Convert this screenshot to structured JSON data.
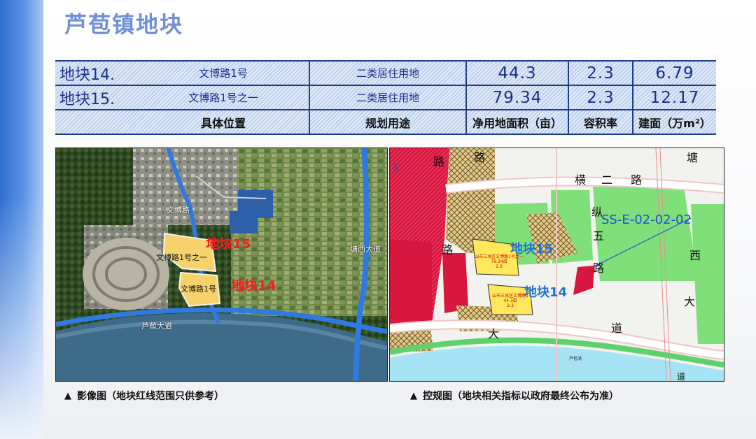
{
  "title": "芦苞镇地块",
  "table": {
    "rows": [
      {
        "id": "地块14.",
        "location": "文博路1号",
        "use": "二类居住用地",
        "area": "44.3",
        "far": "2.3",
        "gfa": "6.79"
      },
      {
        "id": "地块15.",
        "location": "文博路1号之一",
        "use": "二类居住用地",
        "area": "79.34",
        "far": "2.3",
        "gfa": "12.17"
      }
    ],
    "header": {
      "location": "具体位置",
      "use": "规划用途",
      "area": "净用地面积（亩）",
      "far": "容积率",
      "gfa": "建面（万m²）"
    }
  },
  "left_map": {
    "labels": {
      "road_wenbo": "文博路",
      "plot15_address": "文博路1号之一",
      "plot14_address": "文博路1号",
      "plot15": "地块15",
      "plot14": "地块14",
      "road_tangxi": "塘西大道",
      "road_lubao": "芦苞大道"
    },
    "caption": "影像图（地块红线范围只供参考）"
  },
  "right_map": {
    "labels": {
      "corner_number": "1",
      "road_lu_top": "路",
      "road_lu_top2": "路",
      "road_heng": "横",
      "road_er": "二",
      "road_lu_h": "路",
      "road_zong": "纵",
      "road_wu": "五",
      "road_lu_v": "路",
      "road_tang": "塘",
      "road_xi": "西",
      "road_da": "大",
      "road_da2": "大",
      "road_dao": "道",
      "road_lu_mid": "路",
      "zone_code": "SS-E-02-02-02",
      "plot15": "地块15",
      "plot14": "地块14",
      "plot15_label_l1": "山市三水区文博路1号之一",
      "plot15_label_l2": "79.34亩",
      "plot15_label_l3": "2.3",
      "plot14_label_l1": "山市三水区文博路1",
      "plot14_label_l2": "44.3亩",
      "plot14_label_l3": "2.3",
      "river_label": "芦苞涌",
      "road_dao_bottom": "道"
    },
    "caption": "控规图（地块相关指标以政府最终公布为准）"
  },
  "colors": {
    "accent": "#6f8fd8",
    "table_text": "#1a2f8a",
    "plot_label_red": "#ff1a1a",
    "plot_label_blue": "#1f6fd6",
    "residential_yellow": "#ffe95a",
    "commercial_red": "#d8173f",
    "green_space": "#7fe07a",
    "water_blue": "#a6e3f5"
  }
}
